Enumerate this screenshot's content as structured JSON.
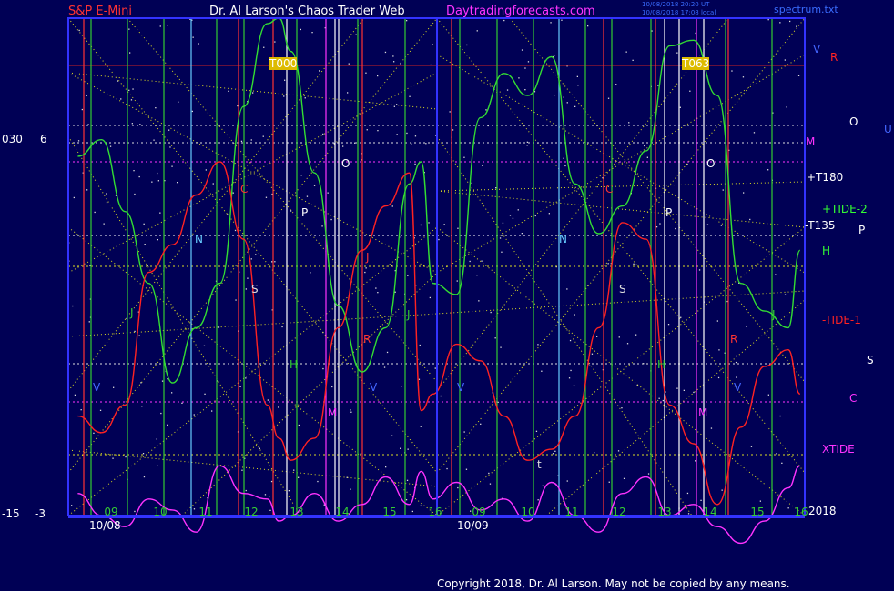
{
  "header": {
    "instrument": "S&P E-Mini",
    "author": "Dr. Al Larson's Chaos Trader Web",
    "site": "Daytradingforecasts.com",
    "stamp_line1": "10/08/2018 20:20 UT",
    "stamp_line2": "10/08/2018 17:08 local",
    "file": "spectrum.txt"
  },
  "footer": {
    "copyright": "Copyright 2018, Dr. Al Larson. May not be copied by any means."
  },
  "colors": {
    "background": "#000055",
    "axis": "#3333ff",
    "price": "#33dd33",
    "tide1": "#ff2222",
    "xtide": "#ff33ff",
    "grid": "#dddd22",
    "vline_white": "#ffffff",
    "vline_cyan": "#66ccff",
    "vline_green": "#33cc33",
    "vline_red": "#ff3333",
    "vline_magenta": "#ff33ff"
  },
  "left_scale": {
    "top_left": "030",
    "top_right": "6",
    "bottom_left": "-15",
    "bottom_right": "-3"
  },
  "right_labels": [
    {
      "text": "V",
      "color": "#4466ff"
    },
    {
      "text": "R",
      "color": "#ff2222"
    },
    {
      "text": "O",
      "color": "#ffffff"
    },
    {
      "text": "U",
      "color": "#4466ff"
    },
    {
      "text": "M",
      "color": "#ff33ff"
    },
    {
      "text": "+T180",
      "color": "#ffffff"
    },
    {
      "text": "+TIDE-2",
      "color": "#33ff33"
    },
    {
      "text": "-T135",
      "color": "#ffffff"
    },
    {
      "text": "P",
      "color": "#ffffff"
    },
    {
      "text": "H",
      "color": "#33ff33"
    },
    {
      "text": "-TIDE-1",
      "color": "#ff2222"
    },
    {
      "text": "S",
      "color": "#ffffff"
    },
    {
      "text": "C",
      "color": "#ff33ff"
    },
    {
      "text": "XTIDE",
      "color": "#ff33ff"
    },
    {
      "text": "2018",
      "color": "#ffffff"
    }
  ],
  "time_markers": [
    "T000",
    "T063"
  ],
  "chart_data": {
    "type": "line",
    "days": [
      "10/08",
      "10/09"
    ],
    "hour_ticks": [
      "09",
      "10",
      "11",
      "12",
      "13",
      "14",
      "15",
      "16"
    ],
    "y_left_range": [
      -15,
      30
    ],
    "y_right_range": [
      -3,
      6
    ],
    "x": [
      9,
      9.5,
      10,
      10.5,
      11,
      11.5,
      12,
      12.5,
      13,
      13.25,
      13.5,
      14,
      14.5,
      15,
      15.5,
      16,
      16.25,
      16.5,
      17,
      17.5,
      18,
      18.5,
      19,
      19.5,
      20,
      20.5,
      21,
      21.5,
      22,
      22.5,
      23,
      23.5,
      24,
      24.25
    ],
    "series": [
      {
        "name": "+TIDE-2",
        "values": [
          3.5,
          3.8,
          2.5,
          1.2,
          -0.6,
          0.4,
          1.2,
          4.4,
          5.9,
          6.0,
          5.4,
          3.2,
          0.8,
          -0.4,
          0.4,
          3.0,
          3.4,
          1.2,
          1.0,
          4.2,
          5.0,
          4.6,
          5.3,
          3.0,
          2.1,
          2.6,
          3.6,
          5.5,
          5.6,
          4.6,
          1.2,
          0.7,
          0.4,
          1.8
        ]
      },
      {
        "name": "-TIDE-1",
        "values": [
          -1.2,
          -1.5,
          -1.0,
          1.4,
          1.9,
          2.8,
          3.4,
          2.0,
          -1.0,
          -1.6,
          -2.0,
          -1.6,
          0.4,
          1.8,
          2.6,
          3.2,
          -1.1,
          -0.8,
          0.1,
          -0.2,
          -1.2,
          -2.0,
          -1.8,
          -1.2,
          0.4,
          2.3,
          2.0,
          -1.0,
          -1.7,
          -2.8,
          -1.4,
          -0.3,
          0.0,
          -0.8
        ]
      },
      {
        "name": "XTIDE",
        "values": [
          -2.6,
          -3.0,
          -3.2,
          -2.7,
          -2.9,
          -3.3,
          -2.1,
          -2.6,
          -2.7,
          -3.1,
          -3.0,
          -2.6,
          -3.1,
          -2.8,
          -2.3,
          -2.8,
          -2.2,
          -2.7,
          -2.4,
          -2.9,
          -2.7,
          -3.1,
          -2.4,
          -3.0,
          -3.3,
          -2.6,
          -2.3,
          -3.0,
          -2.8,
          -3.2,
          -3.5,
          -3.1,
          -2.5,
          -2.1
        ]
      }
    ]
  }
}
